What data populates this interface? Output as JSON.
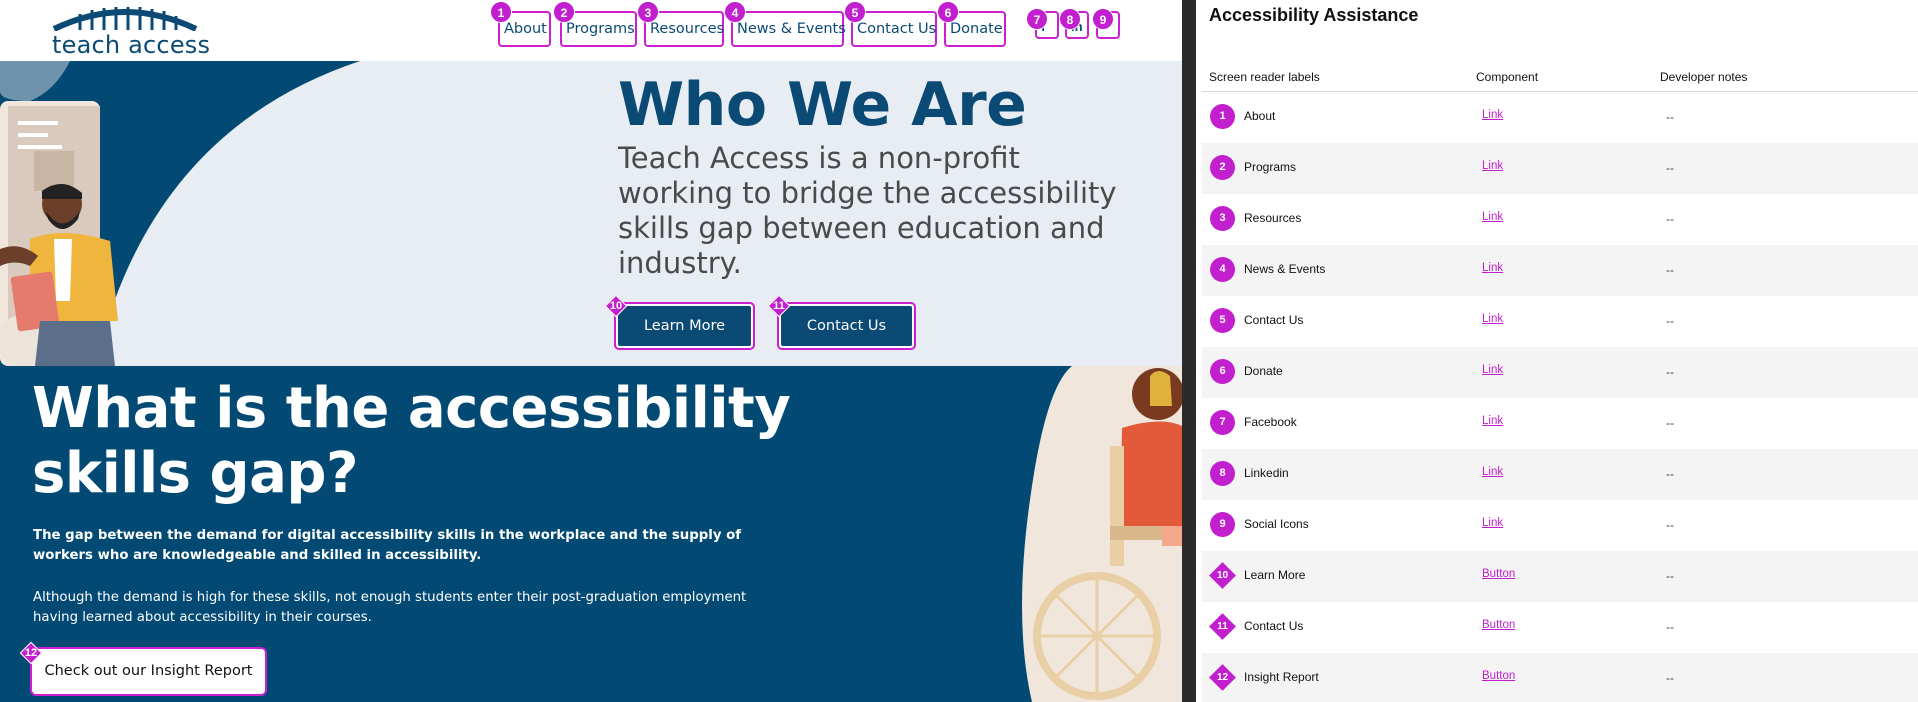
{
  "site": {
    "logo_text": "teach access",
    "nav": [
      {
        "marker": "1",
        "label": "About"
      },
      {
        "marker": "2",
        "label": "Programs"
      },
      {
        "marker": "3",
        "label": "Resources"
      },
      {
        "marker": "4",
        "label": "News & Events"
      },
      {
        "marker": "5",
        "label": "Contact Us"
      },
      {
        "marker": "6",
        "label": "Donate"
      }
    ],
    "social": [
      {
        "marker": "7",
        "icon": "facebook-icon"
      },
      {
        "marker": "8",
        "icon": "linkedin-icon"
      },
      {
        "marker": "9",
        "icon": "social-icon"
      }
    ],
    "hero": {
      "title": "Who We Are",
      "subtitle": "Teach Access is a non-profit working to bridge the accessibility skills gap between education and industry.",
      "buttons": [
        {
          "marker": "10",
          "label": "Learn More"
        },
        {
          "marker": "11",
          "label": "Contact Us"
        }
      ]
    },
    "gap": {
      "title": "What is the accessibility skills gap?",
      "paragraph1": "The gap between the demand for digital accessibility skills in the workplace and the supply of workers who are knowledgeable and skilled in accessibility.",
      "paragraph2": "Although the demand is high for these skills, not enough students enter their post-graduation employment having learned about accessibility in their courses.",
      "button": {
        "marker": "12",
        "label": "Check out our Insight Report"
      }
    },
    "colors": {
      "brand": "#0b4a75",
      "section": "#024a74",
      "annotation": "#c21fcf",
      "hero_bg": "#e7edf2"
    }
  },
  "panel": {
    "title": "Accessibility Assistance",
    "columns": [
      "Screen reader labels",
      "Component",
      "Developer notes"
    ],
    "rows": [
      {
        "num": "1",
        "shape": "circle",
        "label": "About",
        "component": "Link",
        "note": "--"
      },
      {
        "num": "2",
        "shape": "circle",
        "label": "Programs",
        "component": "Link",
        "note": "--"
      },
      {
        "num": "3",
        "shape": "circle",
        "label": "Resources",
        "component": "Link",
        "note": "--"
      },
      {
        "num": "4",
        "shape": "circle",
        "label": "News & Events",
        "component": "Link",
        "note": "--"
      },
      {
        "num": "5",
        "shape": "circle",
        "label": "Contact Us",
        "component": "Link",
        "note": "--"
      },
      {
        "num": "6",
        "shape": "circle",
        "label": "Donate",
        "component": "Link",
        "note": "--"
      },
      {
        "num": "7",
        "shape": "circle",
        "label": "Facebook",
        "component": "Link",
        "note": "--"
      },
      {
        "num": "8",
        "shape": "circle",
        "label": "Linkedin",
        "component": "Link",
        "note": "--"
      },
      {
        "num": "9",
        "shape": "circle",
        "label": "Social Icons",
        "component": "Link",
        "note": "--"
      },
      {
        "num": "10",
        "shape": "diamond",
        "label": "Learn More",
        "component": "Button",
        "note": "--"
      },
      {
        "num": "11",
        "shape": "diamond",
        "label": "Contact Us",
        "component": "Button",
        "note": "--"
      },
      {
        "num": "12",
        "shape": "diamond",
        "label": "Insight Report",
        "component": "Button",
        "note": "--"
      }
    ]
  }
}
